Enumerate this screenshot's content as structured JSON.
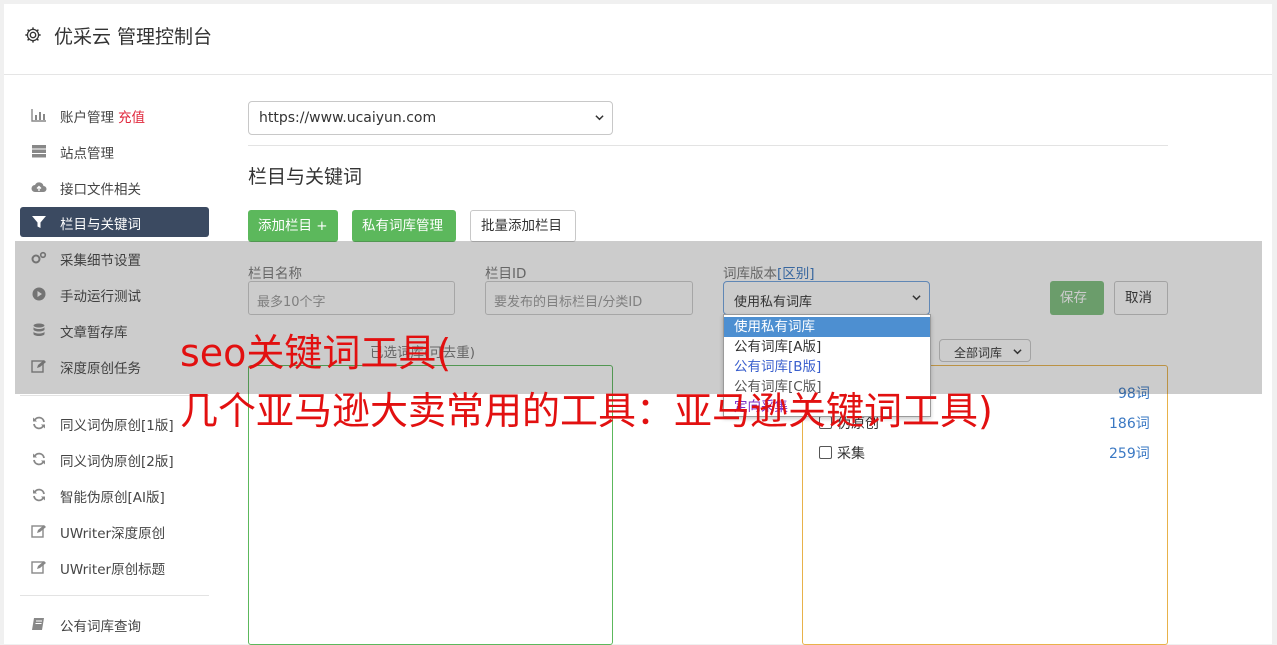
{
  "header": {
    "title": "优采云 管理控制台",
    "icon": "gear-icon"
  },
  "sidebar": {
    "items": [
      {
        "label": "账户管理",
        "badge": "充值",
        "icon": "bar-chart-icon"
      },
      {
        "label": "站点管理",
        "icon": "server-icon"
      },
      {
        "label": "接口文件相关",
        "icon": "cloud-upload-icon"
      },
      {
        "label": "栏目与关键词",
        "icon": "filter-icon",
        "active": true
      },
      {
        "label": "采集细节设置",
        "icon": "gears-icon"
      },
      {
        "label": "手动运行测试",
        "icon": "play-circle-icon"
      },
      {
        "label": "文章暂存库",
        "icon": "database-icon"
      },
      {
        "label": "深度原创任务",
        "icon": "edit-icon"
      },
      {
        "label": "同义词伪原创[1版]",
        "icon": "refresh-icon"
      },
      {
        "label": "同义词伪原创[2版]",
        "icon": "refresh-icon"
      },
      {
        "label": "智能伪原创[AI版]",
        "icon": "refresh-icon"
      },
      {
        "label": "UWriter深度原创",
        "icon": "edit-icon"
      },
      {
        "label": "UWriter原创标题",
        "icon": "edit-icon"
      },
      {
        "label": "公有词库查询",
        "icon": "book-icon"
      }
    ]
  },
  "main": {
    "site_select": {
      "value": "https://www.ucaiyun.com"
    },
    "section_title": "栏目与关键词",
    "buttons": {
      "add_column": "添加栏目 +",
      "private_lib": "私有词库管理",
      "batch_add": "批量添加栏目"
    },
    "form": {
      "name_label": "栏目名称",
      "name_placeholder": "最多10个字",
      "id_label": "栏目ID",
      "id_placeholder": "要发布的目标栏目/分类ID",
      "lib_label": "词库版本",
      "lib_label_link": "[区别]",
      "lib_value": "使用私有词库",
      "save": "保存",
      "cancel": "取消"
    },
    "dropdown_options": [
      "使用私有词库",
      "公有词库[A版]",
      "公有词库[B版]",
      "公有词库[C版]",
      "定向采集"
    ],
    "selected_label_partial": "已选词库(可去重)",
    "filter_select": "全部词库",
    "word_libs": [
      {
        "name": "",
        "count": "98词"
      },
      {
        "name": "伪原创",
        "count": "186词"
      },
      {
        "name": "采集",
        "count": "259词"
      }
    ]
  },
  "watermark": {
    "line1": "seo关键词工具(",
    "line2": "几个亚马逊大卖常用的工具：亚马逊关键词工具)"
  }
}
